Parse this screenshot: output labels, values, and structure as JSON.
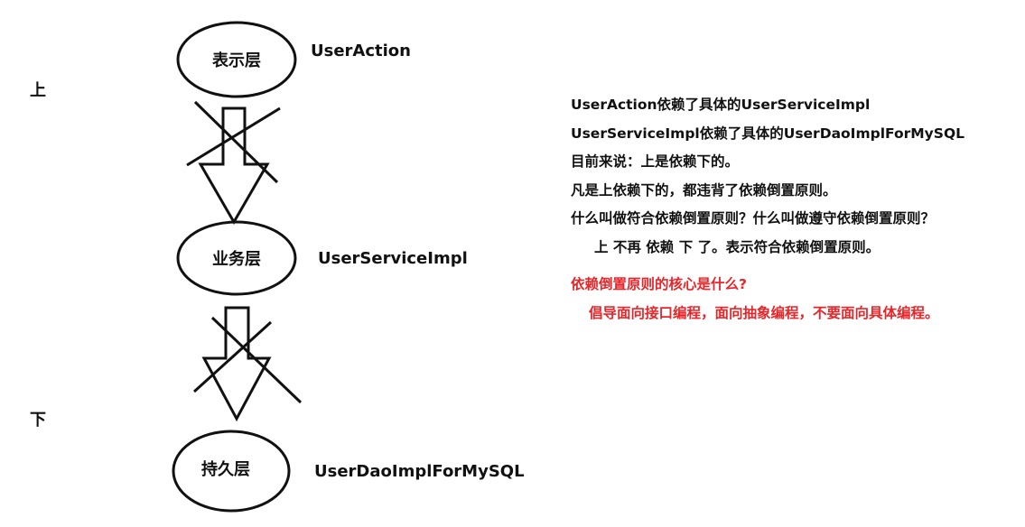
{
  "colors": {
    "ink": "#111111",
    "accent": "#e8262a",
    "background": "#ffffff"
  },
  "layers": [
    {
      "name": "表示层",
      "class_name": "UserAction"
    },
    {
      "name": "业务层",
      "class_name": "UserServiceImpl"
    },
    {
      "name": "持久层",
      "class_name": "UserDaoImplForMySQL"
    }
  ],
  "axis": {
    "top": "上",
    "bottom": "下"
  },
  "notes": [
    "UserAction依赖了具体的UserServiceImpl",
    "UserServiceImpl依赖了具体的UserDaoImplForMySQL",
    "目前来说：上是依赖下的。",
    "凡是上依赖下的，都违背了依赖倒置原则。",
    "什么叫做符合依赖倒置原则？什么叫做遵守依赖倒置原则？",
    "上 不再 依赖 下 了。表示符合依赖倒置原则。"
  ],
  "core": {
    "question": "依赖倒置原则的核心是什么?",
    "answer": "倡导面向接口编程，面向抽象编程，不要面向具体编程。"
  }
}
